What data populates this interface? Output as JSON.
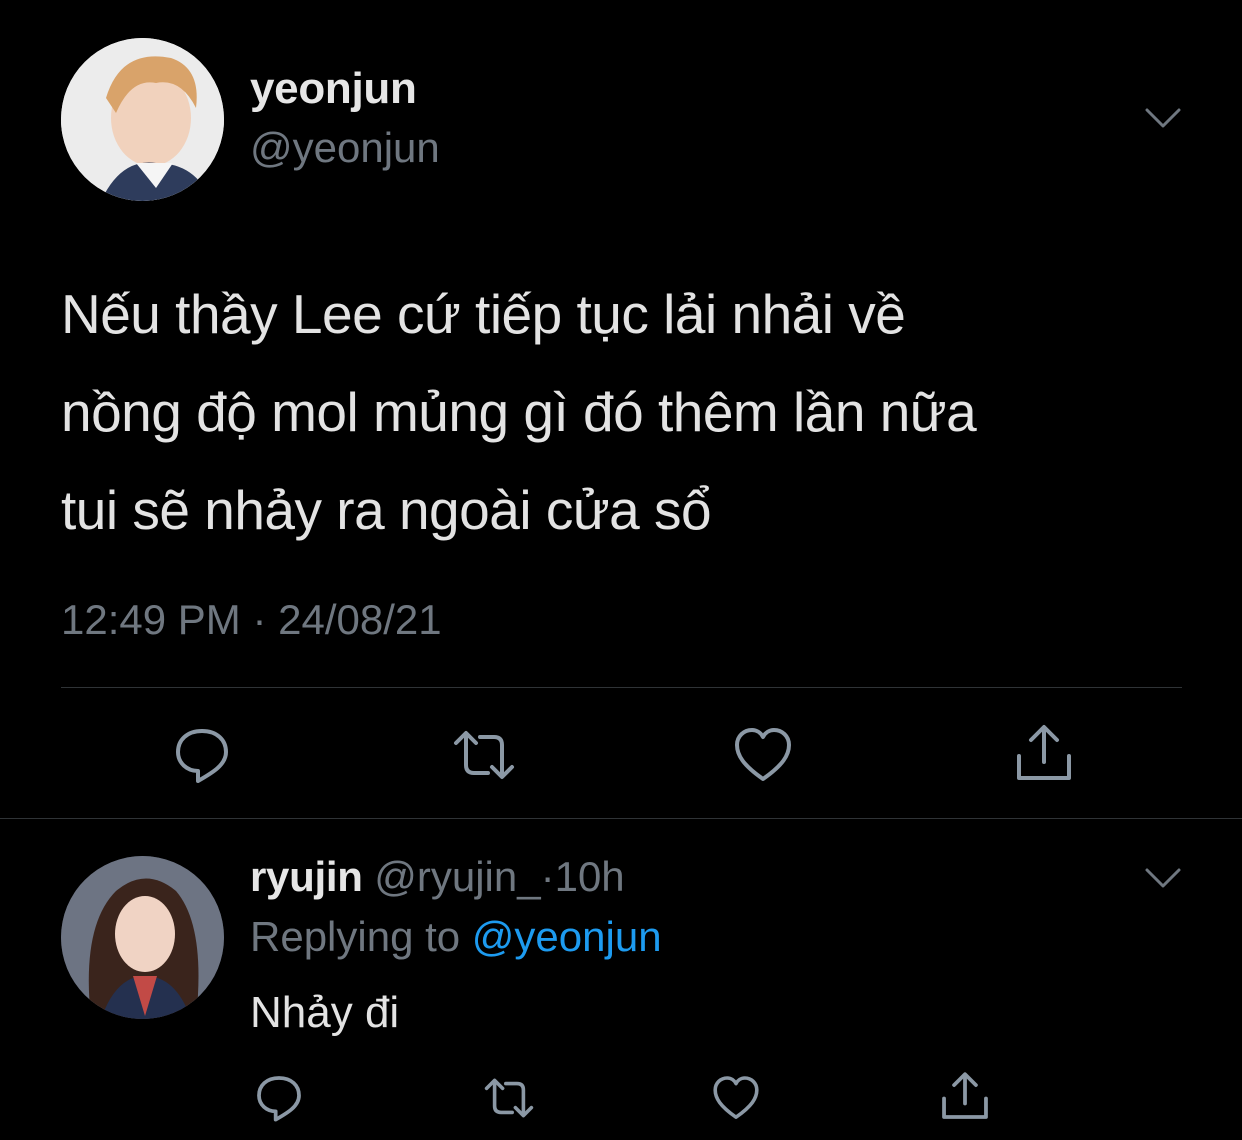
{
  "main_tweet": {
    "display_name": "yeonjun",
    "handle": "@yeonjun",
    "text_lines": [
      "Nếu thầy Lee cứ tiếp tục lải nhải về",
      "nồng độ mol mủng gì đó thêm lần nữa",
      "tui sẽ nhảy ra ngoài cửa sổ"
    ],
    "timestamp": "12:49 PM · 24/08/21",
    "actions": [
      "reply-icon",
      "retweet-icon",
      "like-icon",
      "share-icon"
    ]
  },
  "reply": {
    "display_name": "ryujin",
    "handle": "@ryujin_",
    "separator": "·",
    "time": "10h",
    "replying_label": "Replying to",
    "replying_to": "@yeonjun",
    "text": "Nhảy đi",
    "actions": [
      "reply-icon",
      "retweet-icon",
      "like-icon",
      "share-icon"
    ]
  },
  "colors": {
    "background": "#000000",
    "primary_text": "#e3e3e3",
    "secondary_text": "#6f7780",
    "accent": "#1d9bf0",
    "divider": "#2f3336"
  }
}
